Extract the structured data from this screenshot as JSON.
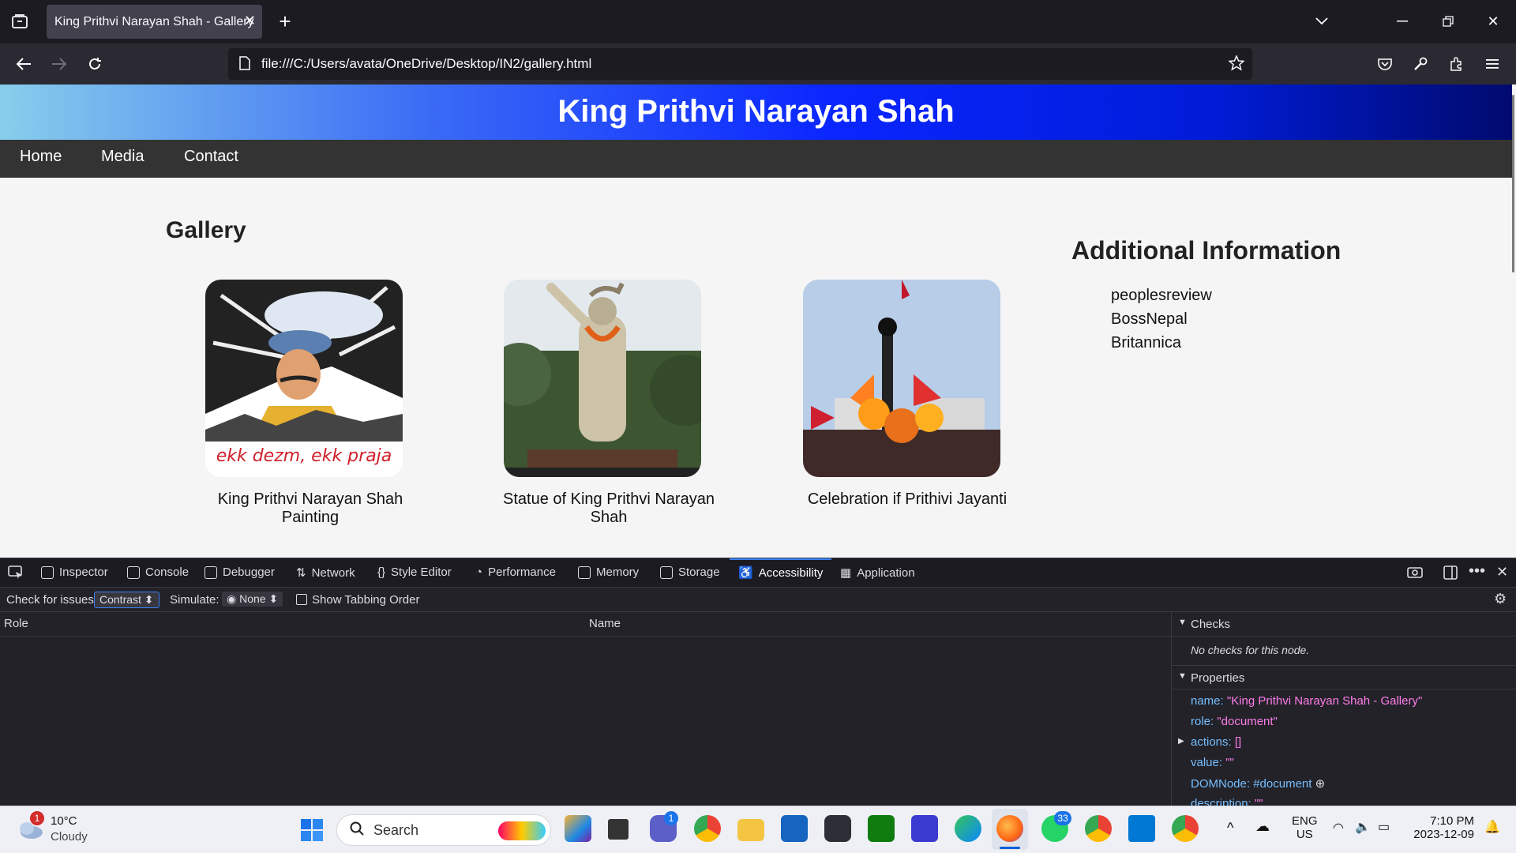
{
  "browser": {
    "tab_title": "King Prithvi Narayan Shah - Gallery",
    "url": "file:///C:/Users/avata/OneDrive/Desktop/IN2/gallery.html"
  },
  "site": {
    "title": "King Prithvi Narayan Shah",
    "nav": [
      "Home",
      "Media",
      "Contact"
    ],
    "gallery_heading": "Gallery",
    "gallery": [
      {
        "caption": "King Prithvi Narayan Shah Painting",
        "image": "portrait-painting"
      },
      {
        "caption": "Statue of King Prithvi Narayan Shah",
        "image": "statue-photo"
      },
      {
        "caption": "Celebration if Prithivi Jayanti",
        "image": "celebration-photo"
      }
    ],
    "additional_heading": "Additional Information",
    "links": [
      "peoplesreview",
      "BossNepal",
      "Britannica"
    ],
    "painting_script": "ekk dezm, ekk praja"
  },
  "devtools": {
    "tabs": [
      "Inspector",
      "Console",
      "Debugger",
      "Network",
      "Style Editor",
      "Performance",
      "Memory",
      "Storage",
      "Accessibility",
      "Application"
    ],
    "active_tab": "Accessibility",
    "check_label": "Check for issues:",
    "check_value": "Contrast",
    "simulate_label": "Simulate:",
    "simulate_value": "None",
    "tabbing_label": "Show Tabbing Order",
    "col_role": "Role",
    "col_name": "Name",
    "checks_heading": "Checks",
    "checks_text": "No checks for this node.",
    "properties_heading": "Properties",
    "properties": [
      {
        "key": "name:",
        "value": "\"King Prithvi Narayan Shah - Gallery\""
      },
      {
        "key": "role:",
        "value": "\"document\""
      },
      {
        "key": "actions:",
        "value": "[]"
      },
      {
        "key": "value:",
        "value": "\"\""
      },
      {
        "key": "DOMNode:",
        "value": "#document"
      },
      {
        "key": "description:",
        "value": "\"\""
      }
    ]
  },
  "taskbar": {
    "weather_temp": "10°C",
    "weather_desc": "Cloudy",
    "weather_badge": "1",
    "search_placeholder": "Search",
    "teams_badge": "1",
    "whatsapp_badge": "33",
    "lang_top": "ENG",
    "lang_bottom": "US",
    "time": "7:10 PM",
    "date": "2023-12-09"
  }
}
